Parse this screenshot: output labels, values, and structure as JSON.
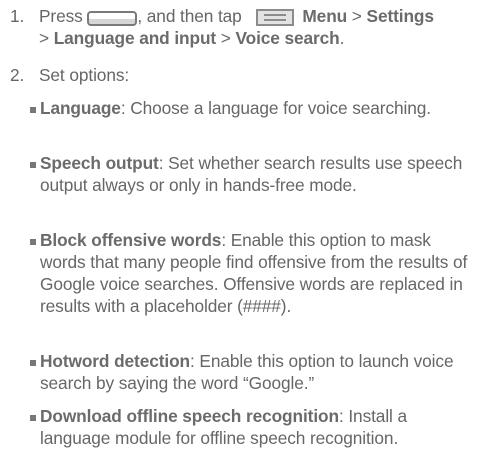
{
  "step1": {
    "number": "1.",
    "press": "Press",
    "then_tap": ", and then tap",
    "menu": "Menu",
    "sep1": " > ",
    "settings": "Settings",
    "sep2": "> ",
    "language_and_input": "Language and input",
    "sep3": " > ",
    "voice_search": "Voice search",
    "end": "."
  },
  "step2": {
    "number": "2.",
    "text": "Set options:"
  },
  "options": [
    {
      "title": "Language",
      "desc": ": Choose a language for voice searching."
    },
    {
      "title": "Speech output",
      "desc": ": Set whether search results use speech output always or only in hands-free mode."
    },
    {
      "title": "Block offensive words",
      "desc": ": Enable this option to mask words that many people find offensive from the results of Google voice searches. Offensive words are replaced in results with a placeholder (####)."
    },
    {
      "title": "Hotword detection",
      "desc": ": Enable this option to launch voice search by saying the word “Google.”"
    },
    {
      "title": "Download offline speech recognition",
      "desc": ": Install a language module for offline speech recognition."
    }
  ],
  "icons": [
    "home-button-icon",
    "menu-icon"
  ]
}
